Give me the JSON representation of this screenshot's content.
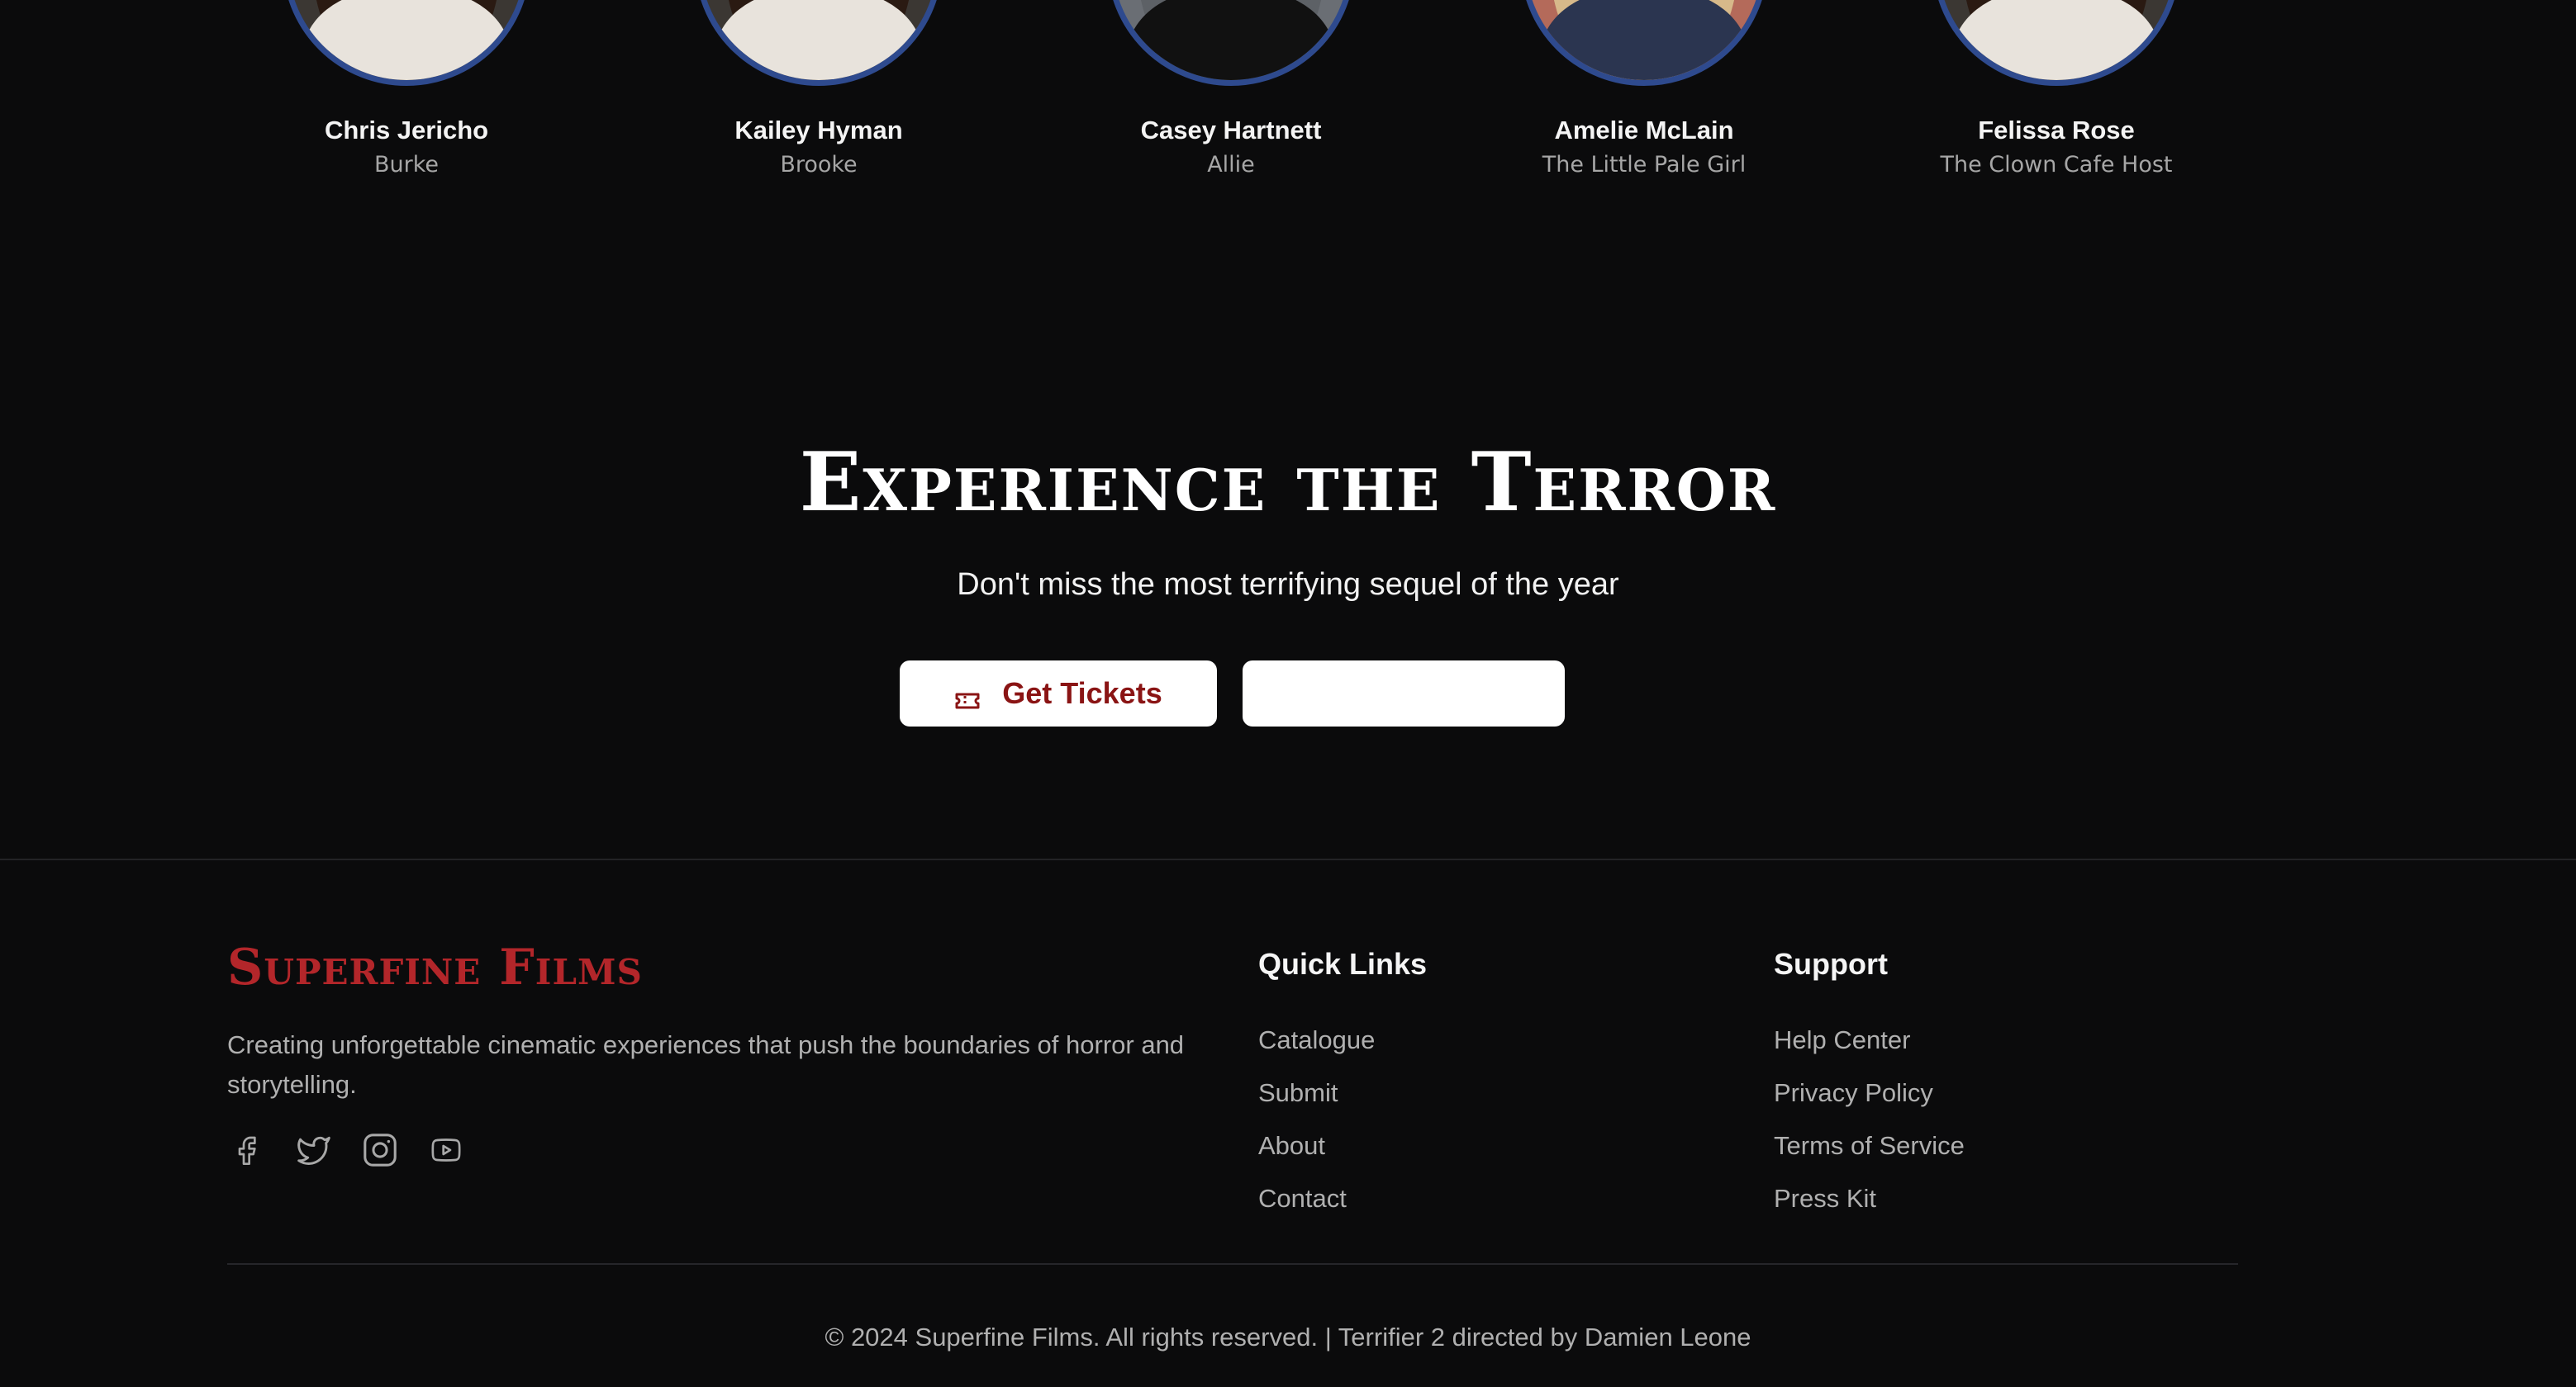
{
  "cast": [
    {
      "name": "Chris Jericho",
      "role": "Burke"
    },
    {
      "name": "Kailey Hyman",
      "role": "Brooke"
    },
    {
      "name": "Casey Hartnett",
      "role": "Allie"
    },
    {
      "name": "Amelie McLain",
      "role": "The Little Pale Girl"
    },
    {
      "name": "Felissa Rose",
      "role": "The Clown Cafe Host"
    }
  ],
  "cta": {
    "title": "Experience the Terror",
    "subtitle": "Don't miss the most terrifying sequel of the year",
    "tickets_label": "Get Tickets",
    "secondary_label": ""
  },
  "footer": {
    "brand": "Superfine Films",
    "tagline": "Creating unforgettable cinematic experiences that push the boundaries of horror and storytelling.",
    "socials": [
      "facebook-icon",
      "twitter-icon",
      "instagram-icon",
      "youtube-icon"
    ],
    "quick_links": {
      "title": "Quick Links",
      "items": [
        "Catalogue",
        "Submit",
        "About",
        "Contact"
      ]
    },
    "support": {
      "title": "Support",
      "items": [
        "Help Center",
        "Privacy Policy",
        "Terms of Service",
        "Press Kit"
      ]
    },
    "copyright": "© 2024 Superfine Films. All rights reserved. | Terrifier 2 directed by Damien Leone"
  },
  "colors": {
    "background": "#0b0b0c",
    "brand_red": "#b3262a",
    "button_text": "#8a1414",
    "avatar_ring": "#2e4a8e",
    "muted_text": "#b0b0b0"
  }
}
